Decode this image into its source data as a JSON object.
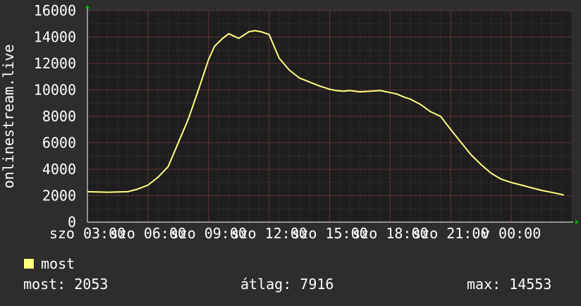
{
  "chart_data": {
    "type": "line",
    "ylabel": "onlinestream.live",
    "ylim": [
      0,
      16000
    ],
    "yticks": [
      0,
      2000,
      4000,
      6000,
      8000,
      10000,
      12000,
      14000,
      16000
    ],
    "xlim_hours": [
      0,
      24
    ],
    "xtick_labels": [
      {
        "hour": 0,
        "label": "szo 03:00"
      },
      {
        "hour": 3,
        "label": "szo 06:00"
      },
      {
        "hour": 6,
        "label": "szo 09:00"
      },
      {
        "hour": 9,
        "label": "szo 12:00"
      },
      {
        "hour": 12,
        "label": "szo 15:00"
      },
      {
        "hour": 15,
        "label": "szo 18:00"
      },
      {
        "hour": 18,
        "label": "szo 21:00"
      },
      {
        "hour": 21,
        "label": "v 00:00"
      }
    ],
    "grid": true,
    "series": [
      {
        "name": "most",
        "color": "#ffff80",
        "x": [
          0,
          0.5,
          1,
          1.5,
          2,
          2.5,
          3,
          3.5,
          4,
          4.5,
          5,
          5.5,
          6,
          6.3,
          6.7,
          7,
          7.5,
          8,
          8.3,
          8.6,
          9,
          9.5,
          10,
          10.5,
          11,
          11.5,
          12,
          12.3,
          12.7,
          13,
          13.5,
          14,
          14.5,
          15,
          15.3,
          15.7,
          16,
          16.5,
          17,
          17.5,
          18,
          18.5,
          19,
          19.5,
          20,
          20.5,
          21,
          21.5,
          22,
          22.5,
          23,
          23.6
        ],
        "values": [
          2300,
          2280,
          2260,
          2280,
          2300,
          2500,
          2800,
          3400,
          4200,
          6000,
          7800,
          10000,
          12300,
          13300,
          13900,
          14250,
          13900,
          14400,
          14480,
          14400,
          14200,
          12400,
          11500,
          10900,
          10600,
          10300,
          10050,
          9950,
          9900,
          9950,
          9850,
          9900,
          9950,
          9800,
          9700,
          9450,
          9300,
          8900,
          8350,
          8000,
          7000,
          6050,
          5100,
          4350,
          3700,
          3250,
          3000,
          2800,
          2600,
          2400,
          2250,
          2053
        ]
      }
    ],
    "legend": [
      {
        "label": "most",
        "color": "#ffff80"
      }
    ],
    "stats": {
      "now": "most: 2053",
      "avg": "átlag: 7916",
      "max": "max: 14553"
    },
    "colors": {
      "background": "#2d2d2d",
      "plot_background": "#1e1e1e",
      "grid_major": "#8c3c3c",
      "grid_minor": "#5a3a3a",
      "axis_arrow": "#00c000",
      "text": "#ffffff"
    }
  }
}
